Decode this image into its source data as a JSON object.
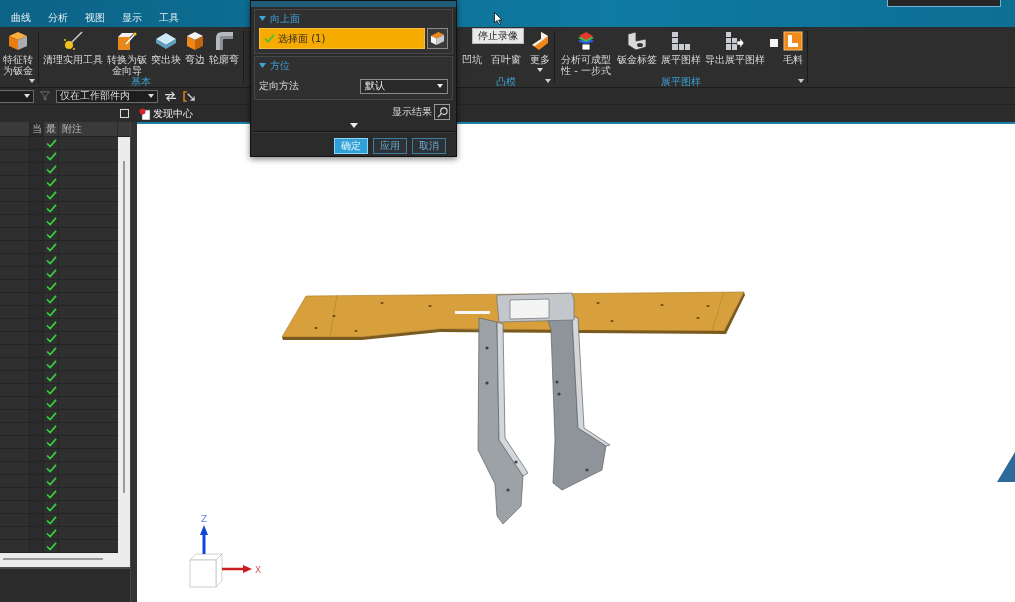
{
  "menu_tabs": [
    {
      "label": "曲线",
      "selected": false
    },
    {
      "label": "分析",
      "selected": false
    },
    {
      "label": "视图",
      "selected": false
    },
    {
      "label": "显示",
      "selected": false
    },
    {
      "label": "工具",
      "selected": false
    }
  ],
  "ribbon": {
    "groups": [
      {
        "launcher": true,
        "items": [
          {
            "kind": "button",
            "label": "特征转为钣金",
            "has_menu": false
          }
        ]
      },
      {
        "label": "基本",
        "items": [
          {
            "kind": "button",
            "label": "清理实用工具",
            "has_menu": false
          },
          {
            "kind": "button",
            "label": "转换为钣金向导",
            "has_menu": false
          },
          {
            "kind": "button",
            "label": "突出块",
            "has_menu": false
          },
          {
            "kind": "button",
            "label": "弯边",
            "has_menu": false
          },
          {
            "kind": "button",
            "label": "轮廓弯",
            "has_menu": false
          }
        ]
      },
      {
        "label": "凸模",
        "launcher": true,
        "items": [
          {
            "kind": "button",
            "label": "凹坑",
            "has_menu": false
          },
          {
            "kind": "button",
            "label": "百叶窗",
            "has_menu": false
          },
          {
            "kind": "button",
            "label": "更多",
            "has_menu": true
          }
        ]
      },
      {
        "label": "展平图样",
        "launcher": true,
        "items": [
          {
            "kind": "button",
            "label": "分析可成型性 - 一步式",
            "has_menu": false
          },
          {
            "kind": "button",
            "label": "钣金标签",
            "has_menu": false
          },
          {
            "kind": "button",
            "label": "展平图样",
            "has_menu": false
          },
          {
            "kind": "button",
            "label": "导出展平图样",
            "has_menu": false
          },
          {
            "kind": "checkbox",
            "checked": false
          },
          {
            "kind": "button",
            "label": "毛料",
            "has_menu": false
          }
        ]
      }
    ]
  },
  "tooltip": {
    "text": "停止录像"
  },
  "toolbar": {
    "scope_filter": "仅在工作部件内"
  },
  "panel_tabs": [
    {
      "label": "发现中心"
    }
  ],
  "navigator": {
    "columns": [
      "当",
      "最",
      "附注"
    ],
    "rows": [
      {
        "newest": true
      },
      {
        "newest": true
      },
      {
        "newest": true
      },
      {
        "newest": true
      },
      {
        "newest": true
      },
      {
        "newest": true
      },
      {
        "newest": true
      },
      {
        "newest": true
      },
      {
        "newest": true
      },
      {
        "newest": true
      },
      {
        "newest": true
      },
      {
        "newest": true
      },
      {
        "newest": true
      },
      {
        "newest": true
      },
      {
        "newest": true
      },
      {
        "newest": true
      },
      {
        "newest": true
      },
      {
        "newest": true
      },
      {
        "newest": true
      },
      {
        "newest": true
      },
      {
        "newest": true
      },
      {
        "newest": true
      },
      {
        "newest": true
      },
      {
        "newest": true
      },
      {
        "newest": true
      },
      {
        "newest": true
      },
      {
        "newest": true
      },
      {
        "newest": true
      },
      {
        "newest": true
      },
      {
        "newest": true
      },
      {
        "newest": true
      },
      {
        "newest": true
      }
    ]
  },
  "dialog": {
    "sections": [
      {
        "kind": "selection",
        "title": "向上面",
        "expanded": true,
        "selection": {
          "label": "选择面 (1)",
          "complete": true,
          "active": true
        }
      },
      {
        "kind": "orientation",
        "title": "方位",
        "expanded": true,
        "field_label": "定向方法",
        "value": "默认"
      }
    ],
    "show_result": "显示结果",
    "buttons": [
      {
        "label": "确定",
        "default": true
      },
      {
        "label": "应用",
        "default": false
      },
      {
        "label": "取消",
        "default": false
      }
    ]
  },
  "view_triad": {
    "z_label": "Z",
    "x_label": "X"
  }
}
